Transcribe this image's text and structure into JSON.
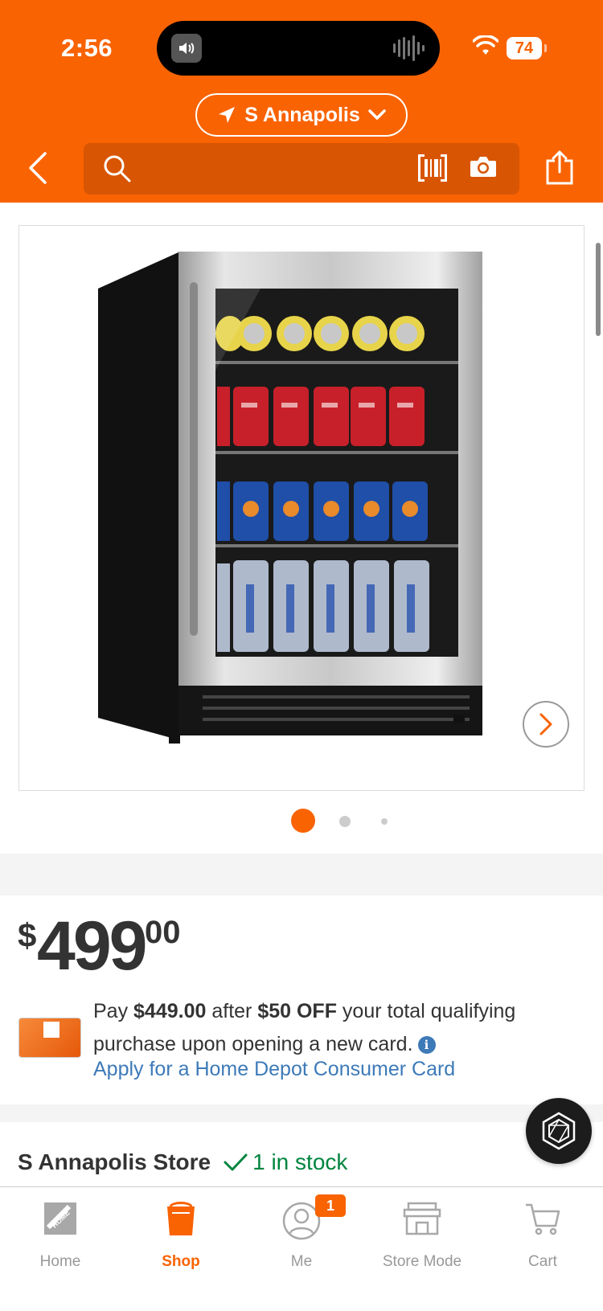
{
  "status_bar": {
    "time": "2:56",
    "battery": "74"
  },
  "header": {
    "store_selector": "S Annapolis",
    "search": {
      "value": "",
      "placeholder": ""
    }
  },
  "gallery": {
    "page_count": 3,
    "active_index": 0,
    "product_image": "beverage-cooler-photo"
  },
  "price": {
    "currency": "$",
    "dollars": "499",
    "cents": "00"
  },
  "promo": {
    "text_pay": "Pay ",
    "promo_price": "$449.00",
    "text_after": " after ",
    "discount": "$50 OFF",
    "text_rest": " your total qualifying purchase upon opening a new card.",
    "apply_link": "Apply for a Home Depot Consumer Card"
  },
  "store": {
    "name": "S Annapolis Store",
    "stock": "1 in stock"
  },
  "tabbar": {
    "home": "Home",
    "shop": "Shop",
    "me": "Me",
    "me_badge": "1",
    "store_mode": "Store Mode",
    "cart": "Cart"
  },
  "colors": {
    "brand": "#f96302",
    "link": "#3d7ab8",
    "in_stock": "#00853f"
  },
  "icons": [
    "back-arrow-icon",
    "search-icon",
    "barcode-icon",
    "camera-icon",
    "share-icon",
    "location-arrow-icon",
    "chevron-down-icon",
    "chevron-right-icon",
    "info-icon",
    "check-icon",
    "home-depot-logo-icon",
    "shop-bucket-icon",
    "user-icon",
    "store-icon",
    "cart-icon",
    "hexagon-assistant-icon"
  ]
}
